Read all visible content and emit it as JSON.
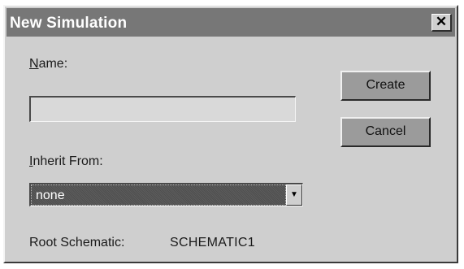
{
  "window": {
    "title": "New Simulation",
    "close_glyph": "✕"
  },
  "form": {
    "name_label_mnemonic": "N",
    "name_label_rest": "ame:",
    "name_value": "",
    "inherit_label_mnemonic": "I",
    "inherit_label_rest": "nherit From:",
    "inherit_selected": "none",
    "dropdown_arrow_glyph": "▼",
    "root_schematic_label": "Root Schematic:",
    "root_schematic_value": "SCHEMATIC1"
  },
  "buttons": {
    "create_label": "Create",
    "cancel_label": "Cancel"
  },
  "icons": {
    "close": "close-icon",
    "dropdown": "chevron-down-icon"
  }
}
